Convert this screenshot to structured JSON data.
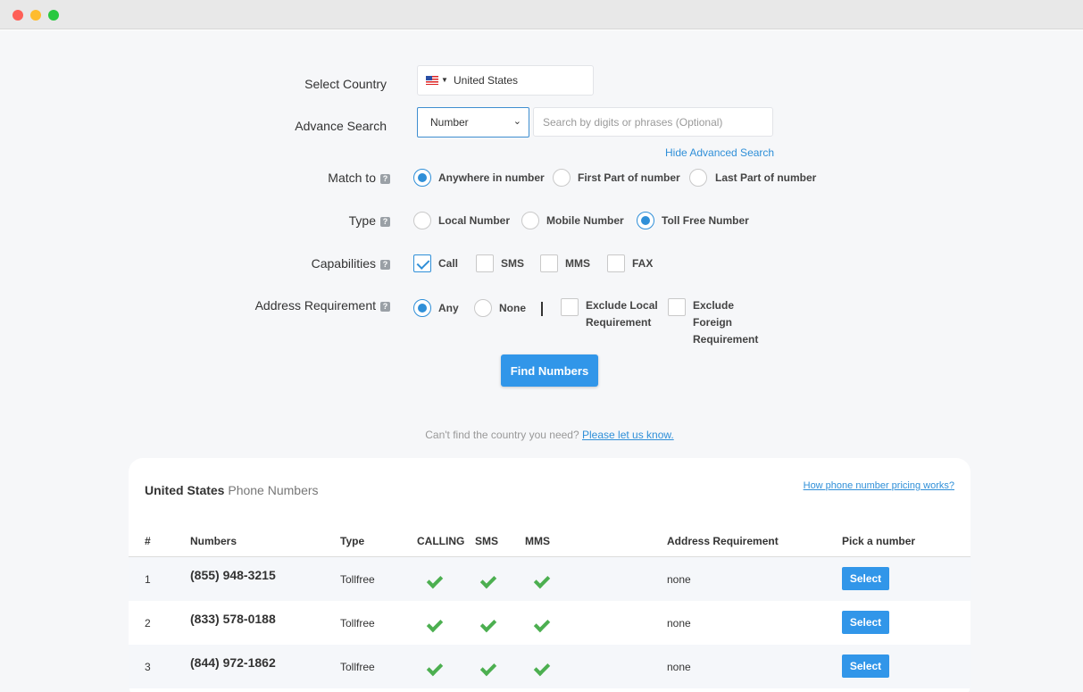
{
  "form": {
    "country_label": "Select Country",
    "country_value": "United States",
    "advance_label": "Advance Search",
    "search_by": "Number",
    "search_placeholder": "Search by digits or phrases (Optional)",
    "hide_advanced": "Hide Advanced Search",
    "match_label": "Match to",
    "match_options": [
      "Anywhere in number",
      "First Part of number",
      "Last Part of number"
    ],
    "match_selected": "Anywhere in number",
    "type_label": "Type",
    "type_options": [
      "Local Number",
      "Mobile Number",
      "Toll Free Number"
    ],
    "type_selected": "Toll Free Number",
    "cap_label": "Capabilities",
    "cap_options": [
      "Call",
      "SMS",
      "MMS",
      "FAX"
    ],
    "cap_checked": [
      "Call"
    ],
    "addr_label": "Address Requirement",
    "addr_options": [
      "Any",
      "None"
    ],
    "addr_selected": "Any",
    "exclude_local": "Exclude Local Requirement",
    "exclude_foreign": "Exclude Foreign Requirement",
    "find_button": "Find Numbers"
  },
  "notice": {
    "text": "Can't find the country you need?",
    "link": "Please let us know."
  },
  "results": {
    "country": "United States",
    "suffix": "Phone Numbers",
    "pricing_link": "How phone number pricing works?",
    "columns": [
      "#",
      "Numbers",
      "Type",
      "CALLING",
      "SMS",
      "MMS",
      "Address Requirement",
      "Pick a number"
    ],
    "rows": [
      {
        "idx": "1",
        "number": "(855) 948-3215",
        "type": "Tollfree",
        "address": "none",
        "action": "Select"
      },
      {
        "idx": "2",
        "number": "(833) 578-0188",
        "type": "Tollfree",
        "address": "none",
        "action": "Select"
      },
      {
        "idx": "3",
        "number": "(844) 972-1862",
        "type": "Tollfree",
        "address": "none",
        "action": "Select"
      }
    ]
  },
  "colors": {
    "accent": "#3196e9",
    "check": "#4caf50",
    "page_bg": "#f6f7f9"
  }
}
